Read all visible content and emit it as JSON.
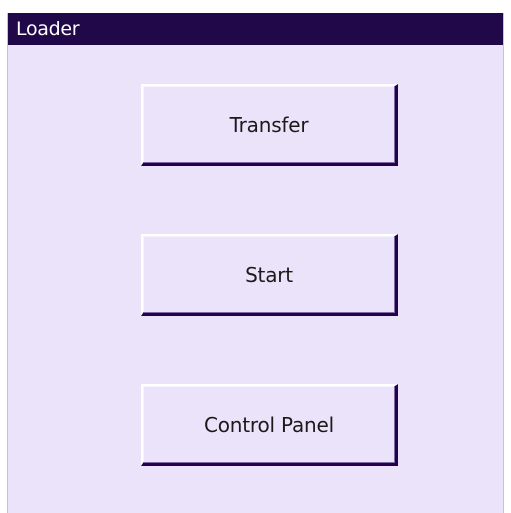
{
  "window": {
    "title": "Loader"
  },
  "buttons": {
    "transfer": "Transfer",
    "start": "Start",
    "control_panel": "Control Panel"
  },
  "colors": {
    "titlebar": "#210848",
    "background": "#ebe3fa",
    "button_shadow": "#24004d"
  }
}
